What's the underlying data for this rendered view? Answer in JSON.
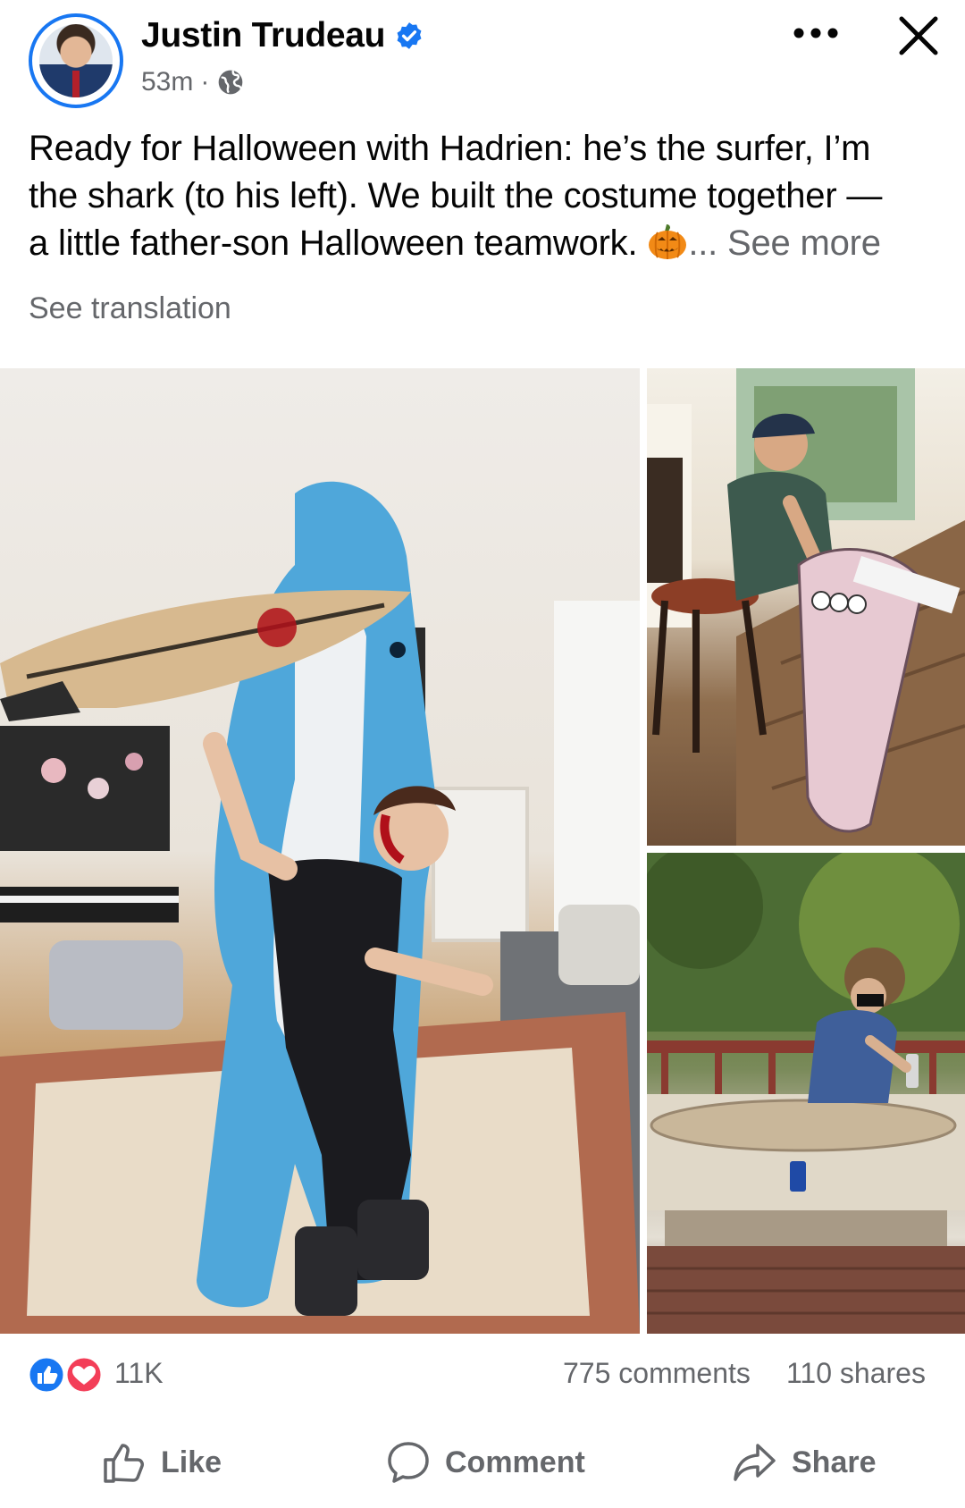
{
  "header": {
    "author_name": "Justin Trudeau",
    "timestamp": "53m",
    "separator": "·",
    "verified_icon": "verified-badge-icon",
    "privacy_icon": "globe-icon",
    "more_icon": "more-dots-icon",
    "close_icon": "close-icon"
  },
  "post": {
    "text_line_1": "Ready for Halloween with Hadrien: he’s the surfer, I’m",
    "text_line_2": "the shark (to his left). We built the costume together —",
    "text_line_3": "a little father-son Halloween teamwork.",
    "see_more": "... See more",
    "see_translation": "See translation"
  },
  "photos": [
    {
      "description_icon": "photo-shark-costume"
    },
    {
      "description_icon": "photo-man-building-surfboard"
    },
    {
      "description_icon": "photo-boy-painting-surfboard"
    }
  ],
  "engagement": {
    "reaction_count": "11K",
    "comments": "775 comments",
    "shares": "110 shares"
  },
  "actions": {
    "like_label": "Like",
    "comment_label": "Comment",
    "share_label": "Share"
  },
  "colors": {
    "accent": "#1877f2",
    "secondary_text": "#65676b",
    "love_red": "#f33e58"
  }
}
